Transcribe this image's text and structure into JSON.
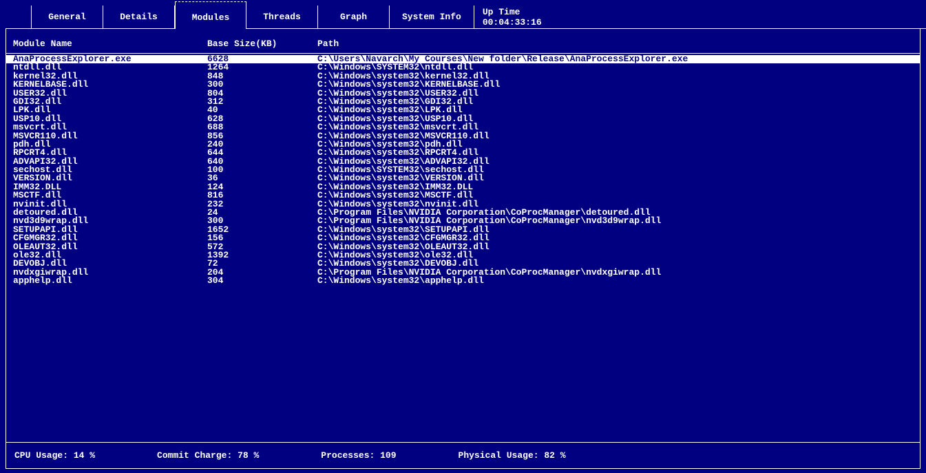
{
  "tabs": [
    {
      "label": "General"
    },
    {
      "label": "Details"
    },
    {
      "label": "Modules"
    },
    {
      "label": "Threads"
    },
    {
      "label": "Graph"
    },
    {
      "label": "System Info"
    }
  ],
  "active_tab_index": 2,
  "uptime": {
    "label": "Up Time",
    "value": "00:04:33:16"
  },
  "columns": {
    "name": "Module Name",
    "size": "Base Size(KB)",
    "path": "Path"
  },
  "rows": [
    {
      "name": "AnaProcessExplorer.exe",
      "size": "6628",
      "path": "C:\\Users\\Navarch\\My Courses\\New folder\\Release\\AnaProcessExplorer.exe",
      "selected": true
    },
    {
      "name": "ntdll.dll",
      "size": "1264",
      "path": "C:\\Windows\\SYSTEM32\\ntdll.dll"
    },
    {
      "name": "kernel32.dll",
      "size": "848",
      "path": "C:\\Windows\\system32\\kernel32.dll"
    },
    {
      "name": "KERNELBASE.dll",
      "size": "300",
      "path": "C:\\Windows\\system32\\KERNELBASE.dll"
    },
    {
      "name": "USER32.dll",
      "size": "804",
      "path": "C:\\Windows\\system32\\USER32.dll"
    },
    {
      "name": "GDI32.dll",
      "size": "312",
      "path": "C:\\Windows\\system32\\GDI32.dll"
    },
    {
      "name": "LPK.dll",
      "size": "40",
      "path": "C:\\Windows\\system32\\LPK.dll"
    },
    {
      "name": "USP10.dll",
      "size": "628",
      "path": "C:\\Windows\\system32\\USP10.dll"
    },
    {
      "name": "msvcrt.dll",
      "size": "688",
      "path": "C:\\Windows\\system32\\msvcrt.dll"
    },
    {
      "name": "MSVCR110.dll",
      "size": "856",
      "path": "C:\\Windows\\system32\\MSVCR110.dll"
    },
    {
      "name": "pdh.dll",
      "size": "240",
      "path": "C:\\Windows\\system32\\pdh.dll"
    },
    {
      "name": "RPCRT4.dll",
      "size": "644",
      "path": "C:\\Windows\\system32\\RPCRT4.dll"
    },
    {
      "name": "ADVAPI32.dll",
      "size": "640",
      "path": "C:\\Windows\\system32\\ADVAPI32.dll"
    },
    {
      "name": "sechost.dll",
      "size": "100",
      "path": "C:\\Windows\\SYSTEM32\\sechost.dll"
    },
    {
      "name": "VERSION.dll",
      "size": "36",
      "path": "C:\\Windows\\system32\\VERSION.dll"
    },
    {
      "name": "IMM32.DLL",
      "size": "124",
      "path": "C:\\Windows\\system32\\IMM32.DLL"
    },
    {
      "name": "MSCTF.dll",
      "size": "816",
      "path": "C:\\Windows\\system32\\MSCTF.dll"
    },
    {
      "name": "nvinit.dll",
      "size": "232",
      "path": "C:\\Windows\\system32\\nvinit.dll"
    },
    {
      "name": "detoured.dll",
      "size": "24",
      "path": "C:\\Program Files\\NVIDIA Corporation\\CoProcManager\\detoured.dll"
    },
    {
      "name": "nvd3d9wrap.dll",
      "size": "300",
      "path": "C:\\Program Files\\NVIDIA Corporation\\CoProcManager\\nvd3d9wrap.dll"
    },
    {
      "name": "SETUPAPI.dll",
      "size": "1652",
      "path": "C:\\Windows\\system32\\SETUPAPI.dll"
    },
    {
      "name": "CFGMGR32.dll",
      "size": "156",
      "path": "C:\\Windows\\system32\\CFGMGR32.dll"
    },
    {
      "name": "OLEAUT32.dll",
      "size": "572",
      "path": "C:\\Windows\\system32\\OLEAUT32.dll"
    },
    {
      "name": "ole32.dll",
      "size": "1392",
      "path": "C:\\Windows\\system32\\ole32.dll"
    },
    {
      "name": "DEVOBJ.dll",
      "size": "72",
      "path": "C:\\Windows\\system32\\DEVOBJ.dll"
    },
    {
      "name": "nvdxgiwrap.dll",
      "size": "204",
      "path": "C:\\Program Files\\NVIDIA Corporation\\CoProcManager\\nvdxgiwrap.dll"
    },
    {
      "name": "apphelp.dll",
      "size": "304",
      "path": "C:\\Windows\\system32\\apphelp.dll"
    }
  ],
  "status": {
    "cpu": {
      "label": "CPU Usage:",
      "value": "14 %"
    },
    "commit": {
      "label": "Commit Charge:",
      "value": "78 %"
    },
    "procs": {
      "label": "Processes:",
      "value": "109"
    },
    "physical": {
      "label": "Physical Usage:",
      "value": "82 %"
    }
  }
}
